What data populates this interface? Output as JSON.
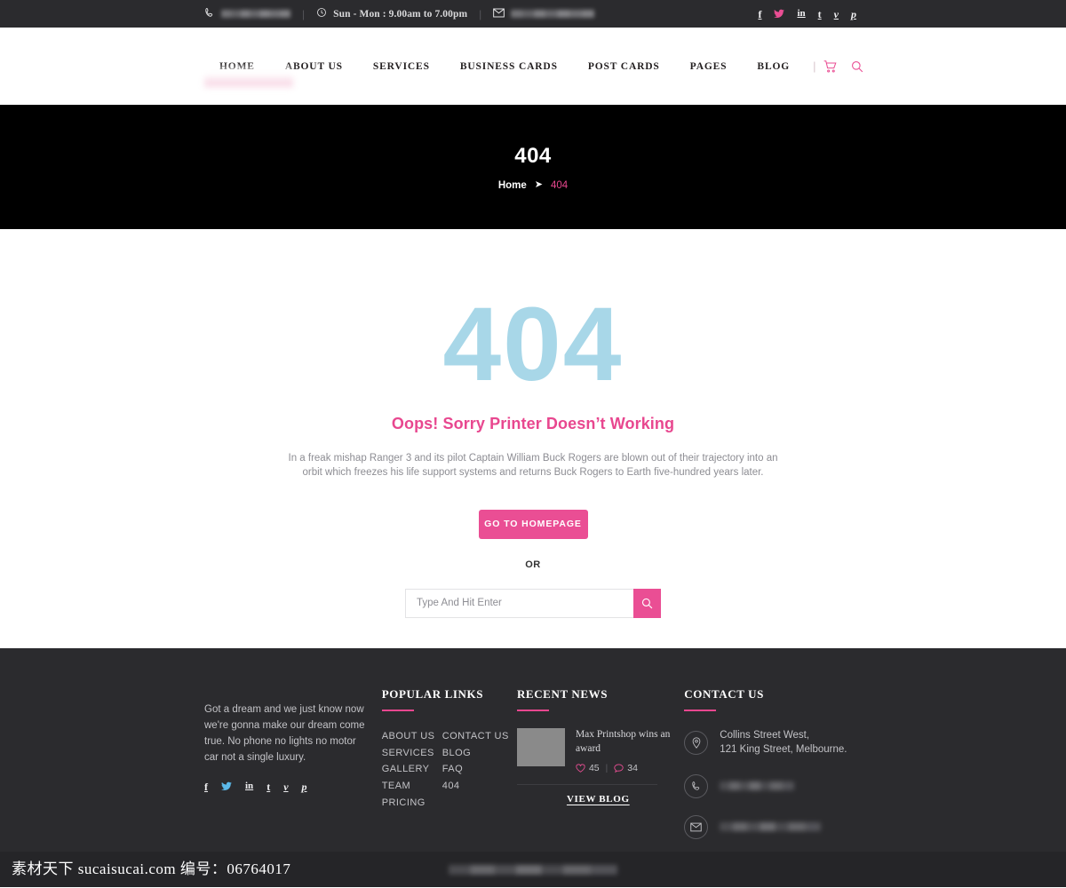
{
  "topbar": {
    "phone_icon": "phone-icon",
    "phone_value": "",
    "clock_icon": "clock-icon",
    "hours": "Sun - Mon : 9.00am to 7.00pm",
    "mail_icon": "mail-icon",
    "email_value": "",
    "separator": "|",
    "socials": [
      {
        "name": "facebook",
        "glyph": "f"
      },
      {
        "name": "twitter",
        "glyph": "t"
      },
      {
        "name": "linkedin",
        "glyph": "in"
      },
      {
        "name": "tumblr",
        "glyph": "t"
      },
      {
        "name": "vimeo",
        "glyph": "v"
      },
      {
        "name": "pinterest",
        "glyph": "p"
      }
    ]
  },
  "header": {
    "logo_alt": "logo",
    "nav": [
      {
        "label": "HOME"
      },
      {
        "label": "ABOUT US"
      },
      {
        "label": "SERVICES"
      },
      {
        "label": "BUSINESS CARDS"
      },
      {
        "label": "POST CARDS"
      },
      {
        "label": "PAGES"
      },
      {
        "label": "BLOG"
      }
    ],
    "divider": "|",
    "cart_icon": "cart-icon",
    "search_icon": "search-icon"
  },
  "banner": {
    "title": "404",
    "crumb_home": "Home",
    "crumb_arrow": "➤",
    "crumb_current": "404"
  },
  "main": {
    "code": "404",
    "headline": "Oops! Sorry Printer Doesn’t Working",
    "description": "In a freak mishap Ranger 3 and its pilot Captain William Buck Rogers are blown out of their trajectory into an orbit which freezes his life support systems and returns Buck Rogers to Earth five-hundred years later.",
    "home_button": "GO TO HOMEPAGE",
    "or": "OR",
    "search_placeholder": "Type And Hit Enter",
    "search_value": "",
    "search_button_icon": "search-icon"
  },
  "footer": {
    "about": {
      "logo_alt": "logo",
      "description": "Got a dream and we just know now we're gonna make our dream come true. No phone no lights no motor car not a single luxury.",
      "socials": [
        {
          "name": "facebook",
          "glyph": "f"
        },
        {
          "name": "twitter",
          "glyph": "t"
        },
        {
          "name": "linkedin",
          "glyph": "in"
        },
        {
          "name": "tumblr",
          "glyph": "t"
        },
        {
          "name": "vimeo",
          "glyph": "v"
        },
        {
          "name": "pinterest",
          "glyph": "p"
        }
      ]
    },
    "popular_links": {
      "title": "POPULAR LINKS",
      "column_a": [
        "ABOUT US",
        "SERVICES",
        "GALLERY",
        "TEAM",
        "PRICING"
      ],
      "column_b": [
        "CONTACT US",
        "BLOG",
        "FAQ",
        "404"
      ]
    },
    "recent_news": {
      "title": "RECENT NEWS",
      "item_title": "Max Printshop wins an award",
      "likes_icon": "heart-icon",
      "likes": "45",
      "meta_divider": "|",
      "comments_icon": "comment-icon",
      "comments": "34",
      "view_blog": "VIEW BLOG"
    },
    "contact": {
      "title": "CONTACT US",
      "address_icon": "location-pin-icon",
      "address_line1": "Collins Street West,",
      "address_line2": "121 King Street, Melbourne.",
      "phone_icon": "phone-icon",
      "phone": "",
      "mail_icon": "mail-icon",
      "email": ""
    },
    "copyright": ""
  },
  "watermark": {
    "text": "素材天下 sucaisucai.com 编号：06764017"
  },
  "colors": {
    "accent_pink": "#e8478f",
    "button_pink": "#ea4e94",
    "code_blue": "#a8d7e8",
    "dark_bg": "#2b2b2e",
    "banner_bg": "#000000"
  }
}
